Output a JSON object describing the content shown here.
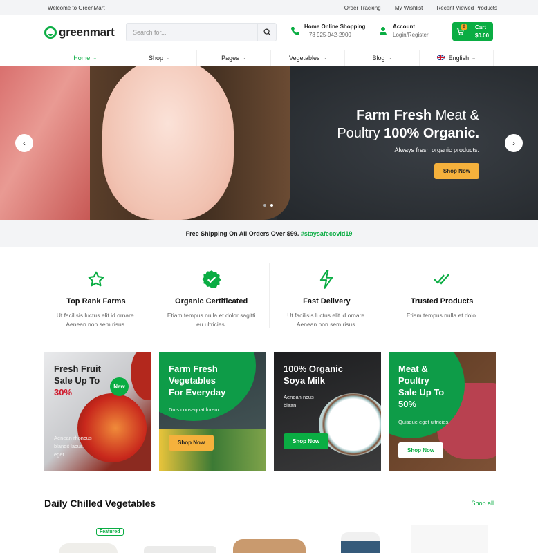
{
  "topbar": {
    "welcome": "Welcome to GreenMart",
    "links": [
      "Order Tracking",
      "My Wishlist",
      "Recent Viewed Products"
    ]
  },
  "header": {
    "logo_text": "greenmart",
    "search_placeholder": "Search for...",
    "contact_title": "Home Online Shopping",
    "contact_phone": "+ 78 925-942-2900",
    "account_title": "Account",
    "account_sub": "Login/Register",
    "cart_label": "Cart",
    "cart_total": "$0.00",
    "cart_count": "0"
  },
  "nav": [
    {
      "label": "Home",
      "active": true
    },
    {
      "label": "Shop"
    },
    {
      "label": "Pages"
    },
    {
      "label": "Vegetables"
    },
    {
      "label": "Blog"
    },
    {
      "label": "English"
    }
  ],
  "hero": {
    "line1_bold": "Farm Fresh",
    "line1_rest": " Meat &",
    "line2_rest": "Poultry ",
    "line2_bold": "100% Organic.",
    "subtitle": "Always fresh organic products.",
    "cta": "Shop Now",
    "slides": 2,
    "active_slide": 2
  },
  "shipping": {
    "text": "Free Shipping On All Orders Over $99. ",
    "tag": "#staysafecovid19"
  },
  "features": [
    {
      "icon": "star-icon",
      "title": "Top Rank Farms",
      "desc1": "Ut facilisis luctus elit id ornare.",
      "desc2": "Aenean non sem risus."
    },
    {
      "icon": "verified-badge-icon",
      "title": "Organic Certificated",
      "desc1": "Etiam tempus nulla et dolor sagitti",
      "desc2": "eu ultricies."
    },
    {
      "icon": "lightning-icon",
      "title": "Fast Delivery",
      "desc1": "Ut facilisis luctus elit id ornare.",
      "desc2": "Aenean non sem risus."
    },
    {
      "icon": "double-check-icon",
      "title": "Trusted Products",
      "desc1": "Etiam tempus nulla et dolo.",
      "desc2": ""
    }
  ],
  "promos": [
    {
      "l1": "Fresh Fruit",
      "l2": "Sale Up To",
      "l3": "30%",
      "badge": "New",
      "desc1": "Aenean rhoncus",
      "desc2": "blandit lacus",
      "desc3": "eget."
    },
    {
      "l1": "Farm Fresh",
      "l2": "Vegetables",
      "l3": "For Everyday",
      "desc1": "Duis consequat lorem.",
      "cta": "Shop Now"
    },
    {
      "l1": "100% Organic",
      "l2": "Soya Milk",
      "desc1": "Aenean ncus",
      "desc2": "blaan.",
      "cta": "Shop Now"
    },
    {
      "l1": "Meat &",
      "l2": "Poultry",
      "l3": "Sale Up To",
      "l4": "50%",
      "desc1": "Quisque eget ultricies.",
      "cta": "Shop Now"
    }
  ],
  "daily": {
    "title": "Daily Chilled Vegetables",
    "shop_all": "Shop all",
    "featured_badge": "Featured"
  },
  "colors": {
    "brand_green": "#0aad43",
    "accent_orange": "#f5b13c",
    "sale_red": "#d0172a"
  }
}
